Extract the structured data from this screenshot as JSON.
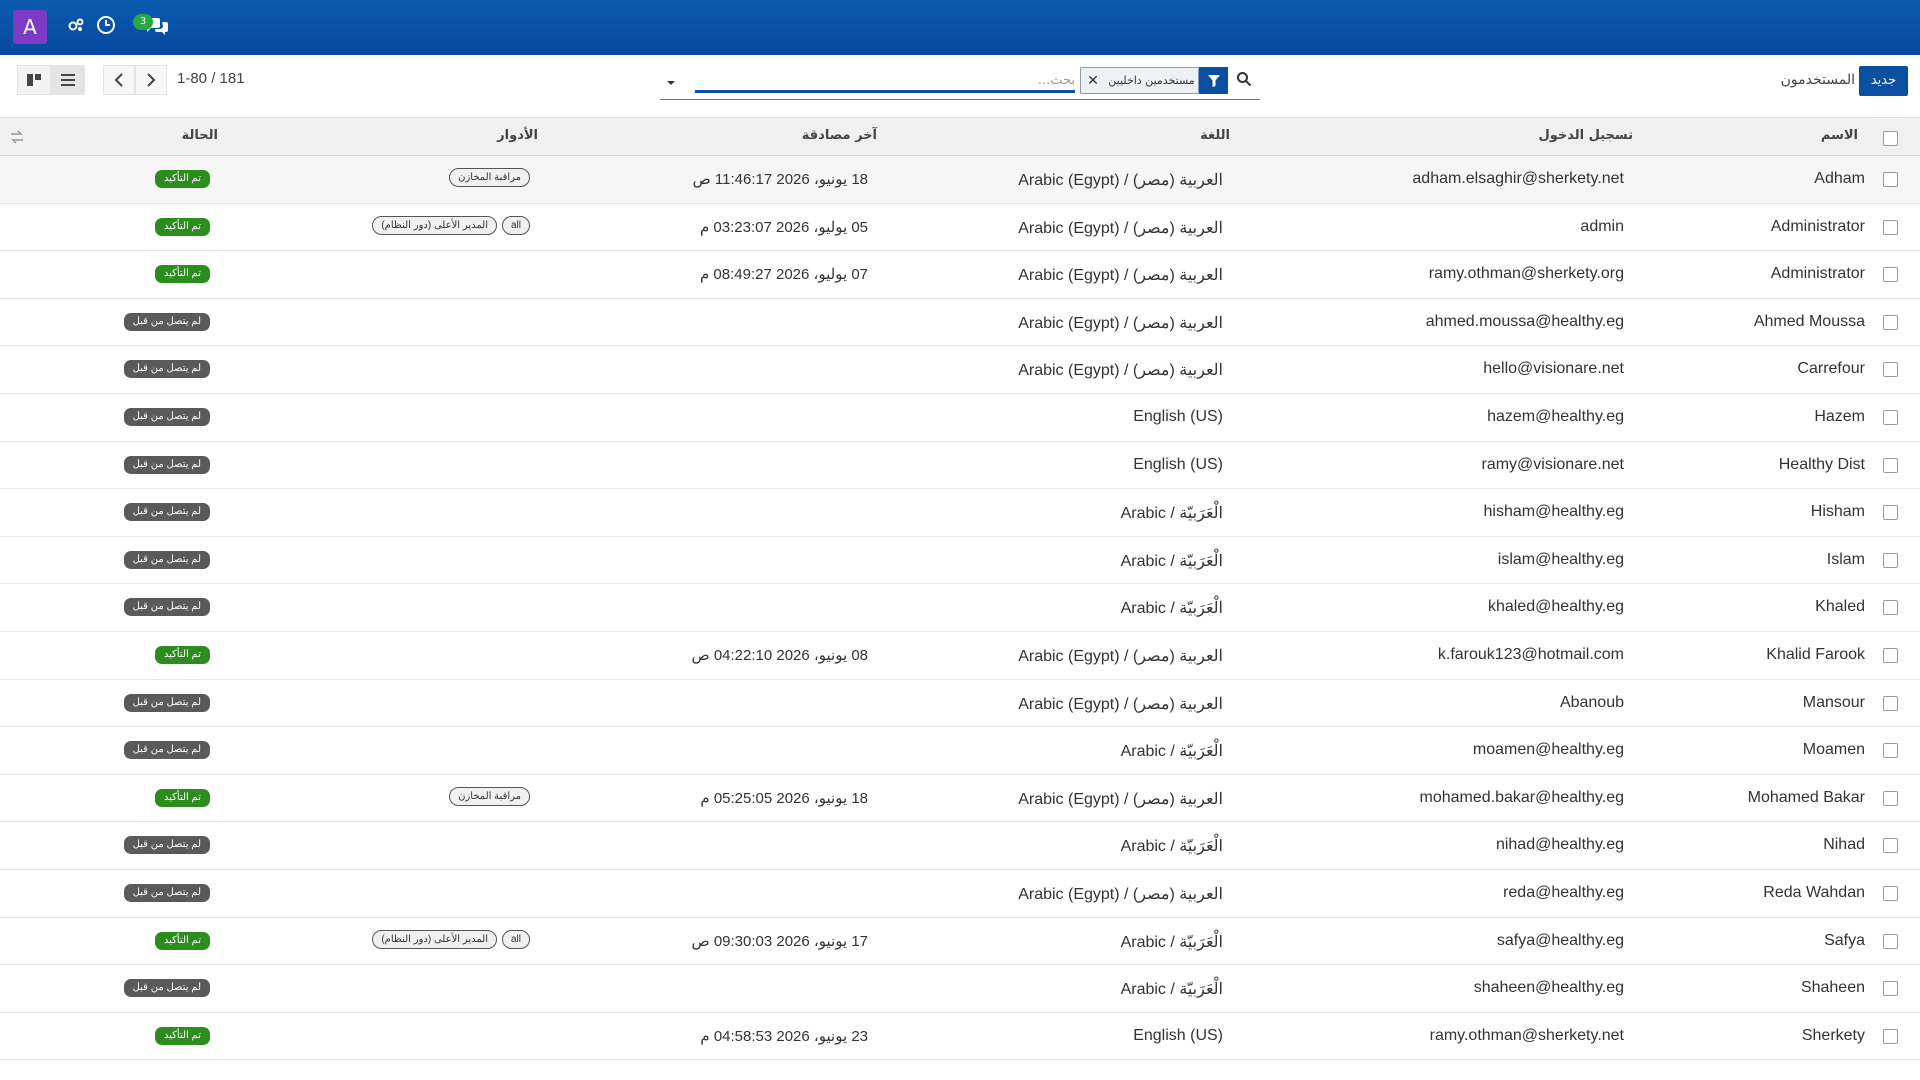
{
  "navbar": {
    "avatar_letter": "A",
    "notification_count": "3"
  },
  "control": {
    "pager": "1-80 / 181",
    "search_placeholder": "بحث...",
    "facet_label": "مستخدمين داخليين",
    "title": "المستخدمون",
    "new_label": "جديد"
  },
  "headers": {
    "name": "الاسم",
    "login": "تسجيل الدخول",
    "language": "اللغة",
    "last_auth": "آخر مصادقة",
    "roles": "الأدوار",
    "status": "الحالة"
  },
  "colors": {
    "navbar": "#0a5bb0",
    "accent": "#0b4fa0",
    "confirmed": "#2c8c1e",
    "never_connected": "#5a5a5a",
    "avatar": "#7b3bc4"
  },
  "users": [
    {
      "name": "Adham",
      "login": "adham.elsaghir@sherkety.net",
      "language": "Arabic (Egypt) / العربية (مصر)",
      "last_auth": "18 يونيو، 2026 11:46:17 ص",
      "roles": [
        "مراقبة المخازن"
      ],
      "status": "تم التأكيد",
      "status_type": "ok"
    },
    {
      "name": "Administrator",
      "login": "admin",
      "language": "Arabic (Egypt) / العربية (مصر)",
      "last_auth": "05 يوليو، 2026 03:23:07 م",
      "roles": [
        "المدير الأعلى (دور النظام)",
        "all"
      ],
      "status": "تم التأكيد",
      "status_type": "ok"
    },
    {
      "name": "Administrator",
      "login": "ramy.othman@sherkety.org",
      "language": "Arabic (Egypt) / العربية (مصر)",
      "last_auth": "07 يوليو، 2026 08:49:27 م",
      "roles": [],
      "status": "تم التأكيد",
      "status_type": "ok"
    },
    {
      "name": "Ahmed Moussa",
      "login": "ahmed.moussa@healthy.eg",
      "language": "Arabic (Egypt) / العربية (مصر)",
      "last_auth": "",
      "roles": [],
      "status": "لم يتصل من قبل",
      "status_type": "never"
    },
    {
      "name": "Carrefour",
      "login": "hello@visionare.net",
      "language": "Arabic (Egypt) / العربية (مصر)",
      "last_auth": "",
      "roles": [],
      "status": "لم يتصل من قبل",
      "status_type": "never"
    },
    {
      "name": "Hazem",
      "login": "hazem@healthy.eg",
      "language": "English (US)",
      "last_auth": "",
      "roles": [],
      "status": "لم يتصل من قبل",
      "status_type": "never"
    },
    {
      "name": "Healthy Dist",
      "login": "ramy@visionare.net",
      "language": "English (US)",
      "last_auth": "",
      "roles": [],
      "status": "لم يتصل من قبل",
      "status_type": "never"
    },
    {
      "name": "Hisham",
      "login": "hisham@healthy.eg",
      "language": "Arabic / الْعَرَبيّة",
      "last_auth": "",
      "roles": [],
      "status": "لم يتصل من قبل",
      "status_type": "never"
    },
    {
      "name": "Islam",
      "login": "islam@healthy.eg",
      "language": "Arabic / الْعَرَبيّة",
      "last_auth": "",
      "roles": [],
      "status": "لم يتصل من قبل",
      "status_type": "never"
    },
    {
      "name": "Khaled",
      "login": "khaled@healthy.eg",
      "language": "Arabic / الْعَرَبيّة",
      "last_auth": "",
      "roles": [],
      "status": "لم يتصل من قبل",
      "status_type": "never"
    },
    {
      "name": "Khalid Farook",
      "login": "k.farouk123@hotmail.com",
      "language": "Arabic (Egypt) / العربية (مصر)",
      "last_auth": "08 يونيو، 2026 04:22:10 ص",
      "roles": [],
      "status": "تم التأكيد",
      "status_type": "ok"
    },
    {
      "name": "Mansour",
      "login": "Abanoub",
      "language": "Arabic (Egypt) / العربية (مصر)",
      "last_auth": "",
      "roles": [],
      "status": "لم يتصل من قبل",
      "status_type": "never"
    },
    {
      "name": "Moamen",
      "login": "moamen@healthy.eg",
      "language": "Arabic / الْعَرَبيّة",
      "last_auth": "",
      "roles": [],
      "status": "لم يتصل من قبل",
      "status_type": "never"
    },
    {
      "name": "Mohamed Bakar",
      "login": "mohamed.bakar@healthy.eg",
      "language": "Arabic (Egypt) / العربية (مصر)",
      "last_auth": "18 يونيو، 2026 05:25:05 م",
      "roles": [
        "مراقبة المخازن"
      ],
      "status": "تم التأكيد",
      "status_type": "ok"
    },
    {
      "name": "Nihad",
      "login": "nihad@healthy.eg",
      "language": "Arabic / الْعَرَبيّة",
      "last_auth": "",
      "roles": [],
      "status": "لم يتصل من قبل",
      "status_type": "never"
    },
    {
      "name": "Reda Wahdan",
      "login": "reda@healthy.eg",
      "language": "Arabic (Egypt) / العربية (مصر)",
      "last_auth": "",
      "roles": [],
      "status": "لم يتصل من قبل",
      "status_type": "never"
    },
    {
      "name": "Safya",
      "login": "safya@healthy.eg",
      "language": "Arabic / الْعَرَبيّة",
      "last_auth": "17 يونيو، 2026 09:30:03 ص",
      "roles": [
        "المدير الأعلى (دور النظام)",
        "all"
      ],
      "status": "تم التأكيد",
      "status_type": "ok"
    },
    {
      "name": "Shaheen",
      "login": "shaheen@healthy.eg",
      "language": "Arabic / الْعَرَبيّة",
      "last_auth": "",
      "roles": [],
      "status": "لم يتصل من قبل",
      "status_type": "never"
    },
    {
      "name": "Sherkety",
      "login": "ramy.othman@sherkety.net",
      "language": "English (US)",
      "last_auth": "23 يونيو، 2026 04:58:53 م",
      "roles": [],
      "status": "تم التأكيد",
      "status_type": "ok"
    }
  ]
}
